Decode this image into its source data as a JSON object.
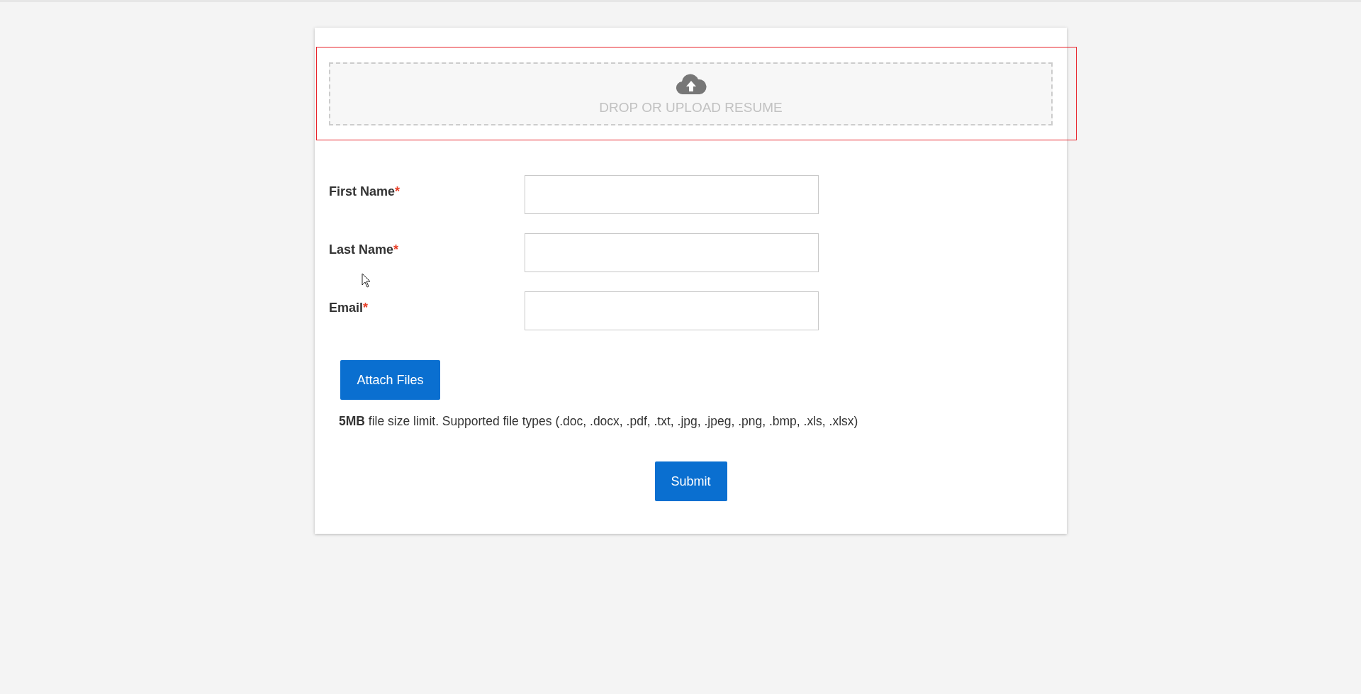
{
  "dropzone": {
    "label": "DROP OR UPLOAD RESUME",
    "highlighted": true
  },
  "fields": [
    {
      "label": "First Name",
      "required_mark": "*"
    },
    {
      "label": "Last Name",
      "required_mark": "*"
    },
    {
      "label": "Email",
      "required_mark": "*"
    }
  ],
  "attach_button": "Attach Files",
  "file_note": "**5MB** file size limit. Supported file types (.doc, .docx, .pdf, .txt, .jpg, .jpeg, .png, .bmp, .xls, .xlsx)",
  "submit_button": "Submit"
}
